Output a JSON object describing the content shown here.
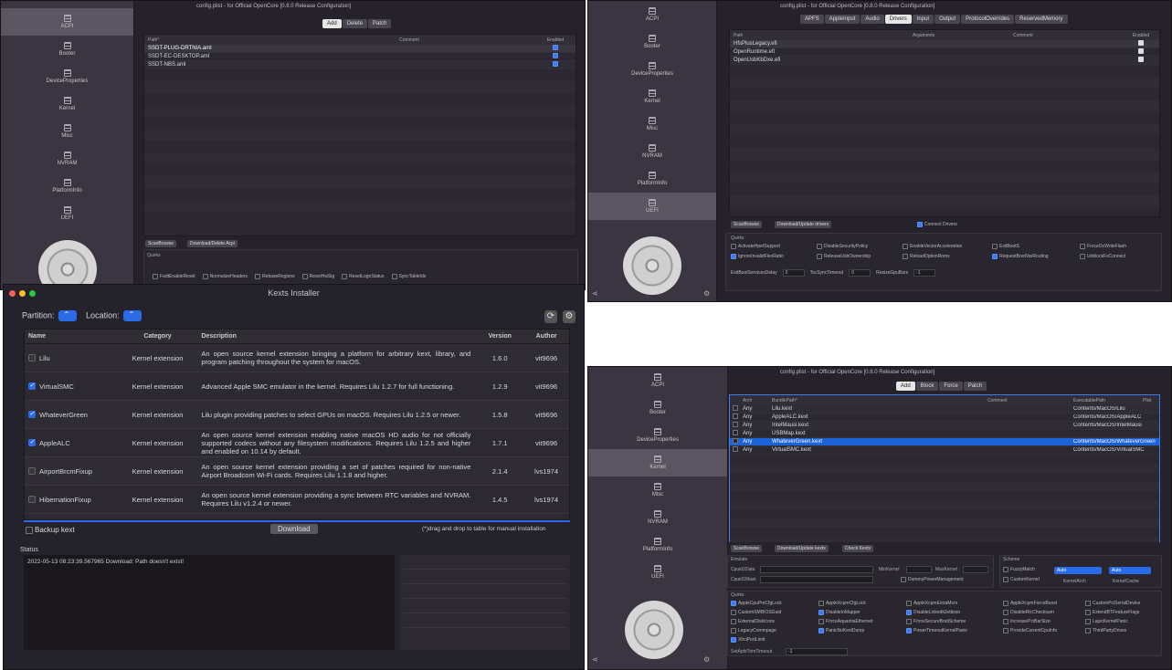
{
  "win_acpi": {
    "title": "config.plist - for Official OpenCore [0.8.0 Release Configuration]",
    "sidebar": [
      "ACPI",
      "Booter",
      "DeviceProperties",
      "Kernel",
      "Misc",
      "NVRAM",
      "PlatformInfo",
      "UEFI"
    ],
    "tabs": [
      "Add",
      "Delete",
      "Patch"
    ],
    "columns": [
      "Path*",
      "Comment",
      "Enabled"
    ],
    "rows": [
      "SSDT-PLUG-DRTNIA.aml",
      "SSDT-EC-DESKTOP.aml",
      "SSDT-NBS.aml"
    ],
    "buttons": [
      "ScanBrowse",
      "Download/Delete Acpi"
    ],
    "quirks_label": "Quirks",
    "quirks": [
      "FadtEnableReset",
      "NormalizeHeaders",
      "RebaseRegions",
      "ResetHwSig",
      "ResetLogoStatus",
      "SyncTableIds"
    ]
  },
  "win_uefi": {
    "title": "config.plist - for Official OpenCore [0.8.0 Release Configuration]",
    "sidebar": [
      "ACPI",
      "Booter",
      "DeviceProperties",
      "Kernel",
      "Misc",
      "NVRAM",
      "PlatformInfo",
      "UEFI"
    ],
    "tabs": [
      "APFS",
      "AppleInput",
      "Audio",
      "Drivers",
      "Input",
      "Output",
      "ProtocolOverrides",
      "ReservedMemory"
    ],
    "columns": [
      "Path",
      "Arguments",
      "Comment",
      "Enabled"
    ],
    "rows": [
      "HfsPlusLegacy.efi",
      "OpenRuntime.efi",
      "OpenUsbKbDxe.efi"
    ],
    "buttons": [
      "ScanBrowse",
      "Download/Update drivers"
    ],
    "connect_label": "Connect Drivers",
    "quirks_label": "Quirks",
    "quirks": [
      [
        "ActivateHpetSupport",
        "DisableSecurityPolicy",
        "EnableVectorAcceleration",
        "ExitBootS",
        "ForceOcWriteFlash"
      ],
      [
        "IgnoreInvalidFlexRatio",
        "ReleaseUsbOwnership",
        "ReloadOptionRoms",
        "RequestBootVarRouting",
        "UnblockFsConnect"
      ]
    ],
    "fields": [
      "ExitBootServicesDelay",
      "TscSyncTimeout",
      "ResizeGpuBars"
    ],
    "field_values": [
      "0",
      "0",
      "-1"
    ]
  },
  "kexts": {
    "title": "Kexts Installer",
    "partition_label": "Partition:",
    "location_label": "Location:",
    "columns": [
      "Name",
      "Category",
      "Description",
      "Version",
      "Author"
    ],
    "rows": [
      {
        "name": "Lilu",
        "checked": false,
        "category": "Kernel extension",
        "desc": "An open source kernel extension bringing a platform for arbitrary kext, library, and program patching throughout the system for macOS.",
        "version": "1.6.0",
        "author": "vit9696"
      },
      {
        "name": "VirtualSMC",
        "checked": true,
        "category": "Kernel extension",
        "desc": "Advanced Apple SMC emulator in the kernel. Requires Lilu 1.2.7 for full functioning.",
        "version": "1.2.9",
        "author": "vit9696"
      },
      {
        "name": "WhateverGreen",
        "checked": true,
        "category": "Kernel extension",
        "desc": "Lilu plugin providing patches to select GPUs on macOS. Requires Lilu 1.2.5 or newer.",
        "version": "1.5.8",
        "author": "vit9696"
      },
      {
        "name": "AppleALC",
        "checked": true,
        "category": "Kernel extension",
        "desc": "An open source kernel extension enabling native macOS HD audio for not officially supported codecs without any filesystem modifications. Requires Lilu 1.2.5 and higher and enabled on 10.14 by default.",
        "version": "1.7.1",
        "author": "vit9696"
      },
      {
        "name": "AirportBrcmFixup",
        "checked": false,
        "category": "Kernel extension",
        "desc": "An open source kernel extension providing a set of patches required for non-native Airport Broadcom Wi-Fi cards. Requires Lilu 1.1.8 and higher.",
        "version": "2.1.4",
        "author": "lvs1974"
      },
      {
        "name": "HibernationFixup",
        "checked": false,
        "category": "Kernel extension",
        "desc": "An open source kernel extension providing a sync between RTC variables and NVRAM. Requires Lilu v1.2.4 or newer.",
        "version": "1.4.5",
        "author": "lvs1974"
      }
    ],
    "backup_label": "Backup kext",
    "download_label": "Download",
    "hint": "(*)drag and drop to table for manual installation",
    "status_label": "Status",
    "log": "2022-05-13 08:23:39.567965 Download: Path doesn't exist!"
  },
  "win_kernel": {
    "title": "config.plist - for Official OpenCore [0.8.0 Release Configuration]",
    "sidebar": [
      "ACPI",
      "Booter",
      "DeviceProperties",
      "Kernel",
      "Misc",
      "NVRAM",
      "PlatformInfo",
      "UEFI"
    ],
    "tabs": [
      "Add",
      "Block",
      "Force",
      "Patch"
    ],
    "columns": [
      "Arch",
      "BundlePath*",
      "Comment",
      "ExecutablePath",
      "Plist"
    ],
    "rows": [
      [
        "Any",
        "Lilu.kext",
        "Contents/MacOS/Lilu"
      ],
      [
        "Any",
        "AppleALC.kext",
        "Contents/MacOS/AppleALC"
      ],
      [
        "Any",
        "IntelMausi.kext",
        "Contents/MacOS/IntelMausi"
      ],
      [
        "Any",
        "USBMap.kext",
        ""
      ],
      [
        "Any",
        "WhateverGreen.kext",
        "Contents/MacOS/WhateverGreen"
      ],
      [
        "Any",
        "VirtualSMC.kext",
        "Contents/MacOS/VirtualSMC"
      ]
    ],
    "buttons": [
      "ScanBrowse",
      "Download/Update kexts",
      "Check Kexts"
    ],
    "emulate_label": "Emulate",
    "emulate_fields": [
      "Cpuid1Data",
      "Cpuid1Mask",
      "MinKernel",
      "MaxKernel"
    ],
    "dummy_label": "DummyPowerManagement",
    "scheme_label": "Scheme",
    "scheme": [
      "FuzzyMatch",
      "CustomKernel",
      "KernelArch",
      "KernelCache"
    ],
    "auto": "Auto",
    "quirks_label": "Quirks",
    "quirks": [
      [
        "AppleCpuPmCfgLock",
        "AppleXcpmCfgLock",
        "AppleXcpmExtraMsrs",
        "AppleXcpmForceBoost",
        "CustomPciSerialDevice"
      ],
      [
        "CustomSMBIOSGuid",
        "DisableIoMapper",
        "DisableLinkeditJettison",
        "DisableRtcChecksum",
        "ExtendBTFeatureFlags"
      ],
      [
        "ExternalDiskIcons",
        "ForceAquantiaEthernet",
        "ForceSecureBootScheme",
        "IncreasePciBarSize",
        "LapicKernelPanic"
      ],
      [
        "LegacyCommpage",
        "PanicNoKextDump",
        "PowerTimeoutKernelPanic",
        "ProvideCurrentCpuInfo",
        "ThirdPartyDrives"
      ],
      [
        "XhciPortLimit"
      ]
    ],
    "delay_label": "SetApfsTrimTimeout",
    "delay_value": "-1"
  },
  "colors": {
    "accent": "#2a6be8",
    "bg": "#26222b",
    "sidebar": "#3a3540"
  }
}
